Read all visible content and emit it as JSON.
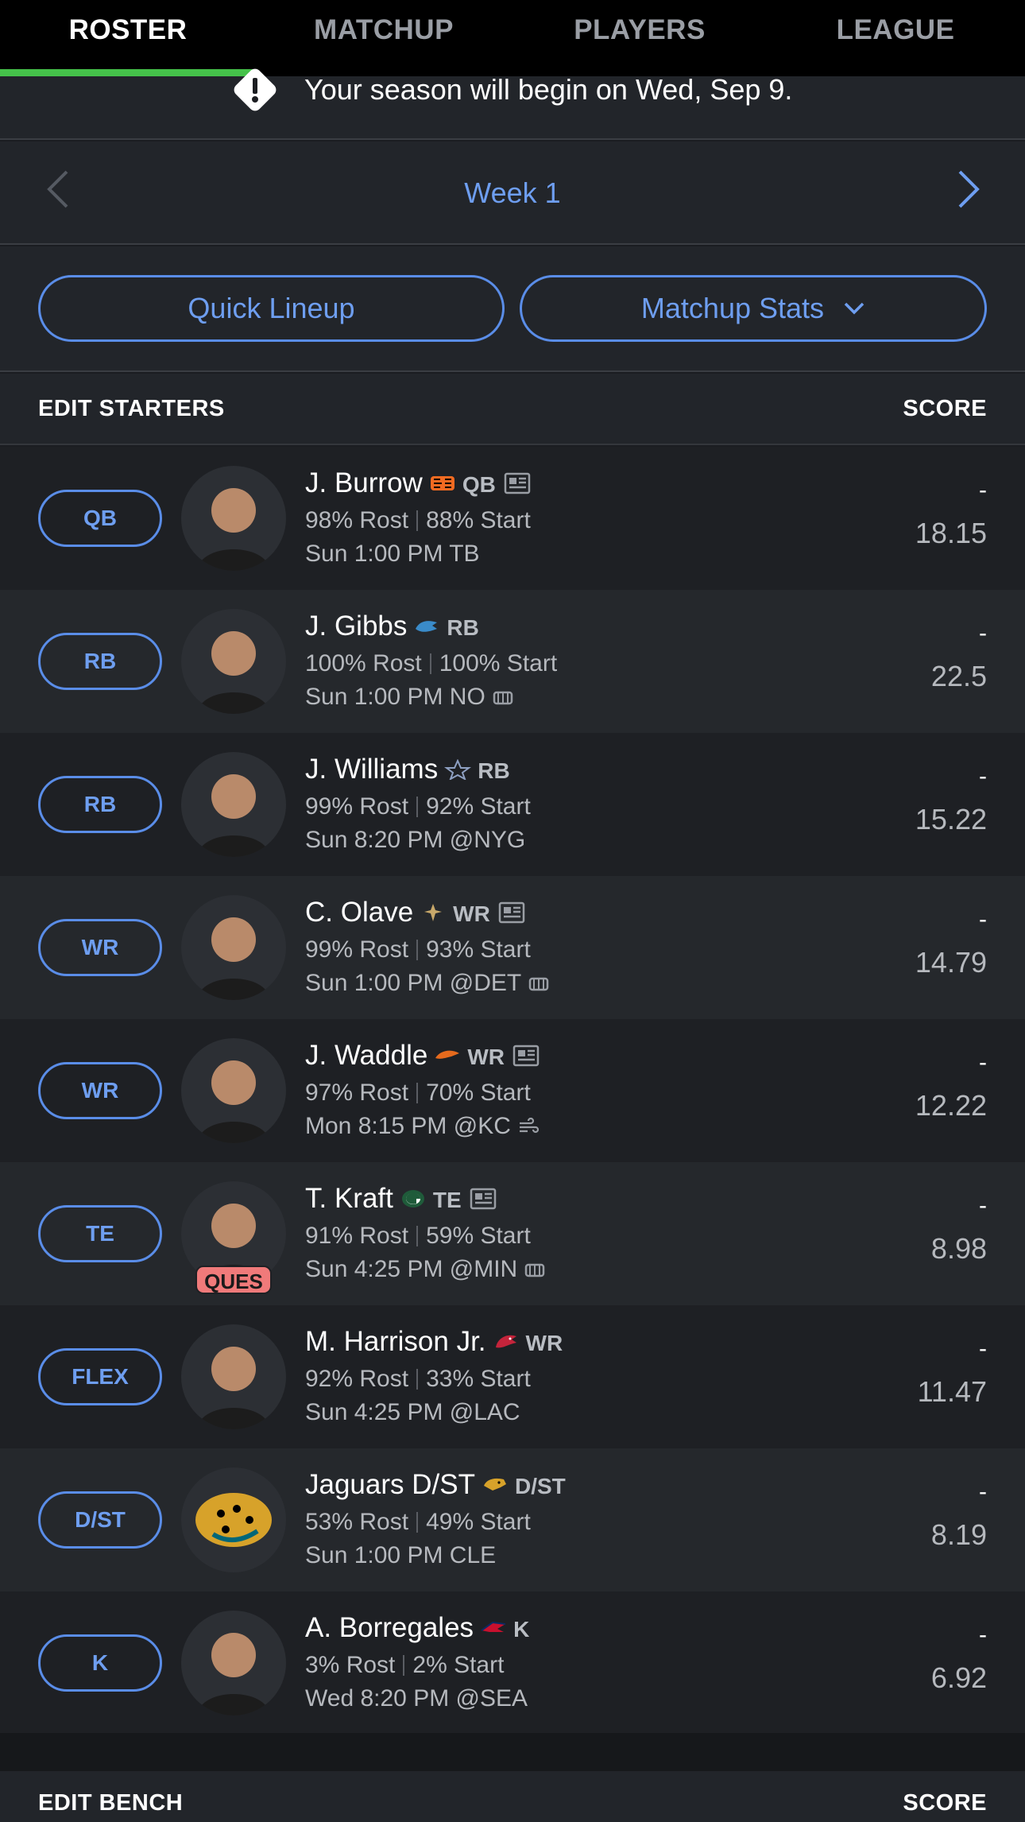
{
  "tabs": [
    {
      "label": "ROSTER"
    },
    {
      "label": "MATCHUP"
    },
    {
      "label": "PLAYERS"
    },
    {
      "label": "LEAGUE"
    }
  ],
  "banner": {
    "text": "Your season will begin on Wed, Sep 9."
  },
  "week": {
    "label": "Week 1"
  },
  "buttons": {
    "quick_lineup": "Quick Lineup",
    "matchup_stats": "Matchup Stats"
  },
  "starters_header": {
    "label": "EDIT STARTERS",
    "score": "SCORE"
  },
  "bench_header": {
    "label": "EDIT BENCH",
    "score": "SCORE"
  },
  "players": [
    {
      "slot": "QB",
      "name": "J. Burrow",
      "pos": "QB",
      "rost": "98% Rost",
      "start": "88% Start",
      "game": "Sun 1:00 PM TB",
      "score": "-",
      "proj": "18.15",
      "news": true,
      "game_icon": ""
    },
    {
      "slot": "RB",
      "name": "J. Gibbs",
      "pos": "RB",
      "rost": "100% Rost",
      "start": "100% Start",
      "game": "Sun 1:00 PM NO",
      "score": "-",
      "proj": "22.5",
      "news": false,
      "game_icon": "stadium-icon"
    },
    {
      "slot": "RB",
      "name": "J. Williams",
      "pos": "RB",
      "rost": "99% Rost",
      "start": "92% Start",
      "game": "Sun 8:20 PM @NYG",
      "score": "-",
      "proj": "15.22",
      "news": false,
      "game_icon": ""
    },
    {
      "slot": "WR",
      "name": "C. Olave",
      "pos": "WR",
      "rost": "99% Rost",
      "start": "93% Start",
      "game": "Sun 1:00 PM @DET",
      "score": "-",
      "proj": "14.79",
      "news": true,
      "game_icon": "stadium-icon"
    },
    {
      "slot": "WR",
      "name": "J. Waddle",
      "pos": "WR",
      "rost": "97% Rost",
      "start": "70% Start",
      "game": "Mon 8:15 PM @KC",
      "score": "-",
      "proj": "12.22",
      "news": true,
      "game_icon": "wind-icon"
    },
    {
      "slot": "TE",
      "name": "T. Kraft",
      "pos": "TE",
      "rost": "91% Rost",
      "start": "59% Start",
      "game": "Sun 4:25 PM @MIN",
      "score": "-",
      "proj": "8.98",
      "news": true,
      "game_icon": "stadium-icon",
      "status": "QUES"
    },
    {
      "slot": "FLEX",
      "name": "M. Harrison Jr.",
      "pos": "WR",
      "rost": "92% Rost",
      "start": "33% Start",
      "game": "Sun 4:25 PM @LAC",
      "score": "-",
      "proj": "11.47",
      "news": false,
      "game_icon": ""
    },
    {
      "slot": "D/ST",
      "name": "Jaguars D/ST",
      "pos": "D/ST",
      "rost": "53% Rost",
      "start": "49% Start",
      "game": "Sun 1:00 PM CLE",
      "score": "-",
      "proj": "8.19",
      "news": false,
      "game_icon": ""
    },
    {
      "slot": "K",
      "name": "A. Borregales",
      "pos": "K",
      "rost": "3% Rost",
      "start": "2% Start",
      "game": "Wed 8:20 PM @SEA",
      "score": "-",
      "proj": "6.92",
      "news": false,
      "game_icon": ""
    }
  ],
  "colors": {
    "accent": "#6e9ef0",
    "active_tab": "#45c24a",
    "ques_badge": "#f07a7a"
  }
}
